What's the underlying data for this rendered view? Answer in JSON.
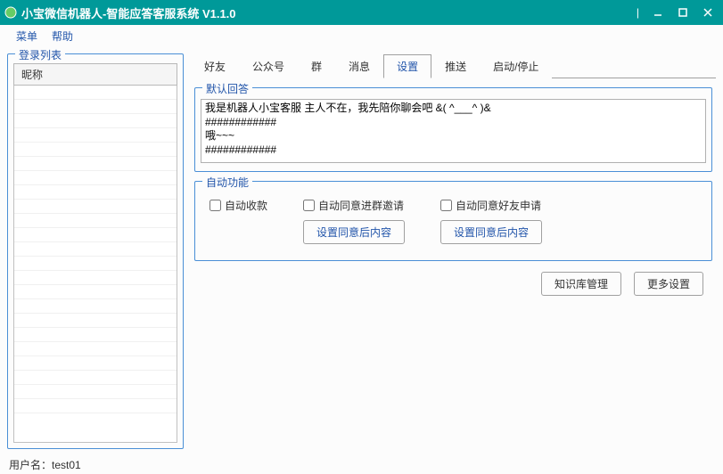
{
  "window": {
    "title": "小宝微信机器人-智能应答客服系统 V1.1.0"
  },
  "menubar": {
    "menu": "菜单",
    "help": "帮助"
  },
  "leftPanel": {
    "legend": "登录列表",
    "columnHeader": "昵称"
  },
  "tabs": {
    "items": [
      "好友",
      "公众号",
      "群",
      "消息",
      "设置",
      "推送",
      "启动/停止"
    ],
    "activeIndex": 4
  },
  "settings": {
    "defaultReply": {
      "legend": "默认回答",
      "text": "我是机器人小宝客服 主人不在，我先陪你聊会吧 &( ^___^ )&\n############\n哦~~~\n############"
    },
    "autoFn": {
      "legend": "自动功能",
      "autoCollect": "自动收款",
      "autoGroupInvite": "自动同意进群邀请",
      "autoFriendReq": "自动同意好友申请",
      "setContentBtn": "设置同意后内容"
    },
    "buttons": {
      "kbManage": "知识库管理",
      "moreSettings": "更多设置"
    }
  },
  "statusbar": {
    "userLabel": "用户名：",
    "userName": "test01"
  }
}
